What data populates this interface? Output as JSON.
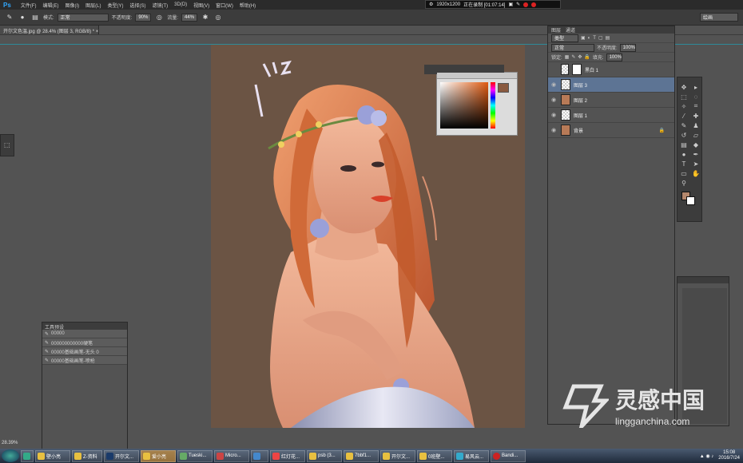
{
  "menubar": {
    "app_logo": "Ps",
    "items": [
      "文件(F)",
      "编辑(E)",
      "图像(I)",
      "图层(L)",
      "类型(Y)",
      "选择(S)",
      "滤镜(T)",
      "3D(D)",
      "视图(V)",
      "窗口(W)",
      "帮助(H)"
    ]
  },
  "recorder": {
    "resolution": "1920x1200",
    "status": "正在录制 [01:07:14]"
  },
  "options_bar": {
    "mode_label": "模式:",
    "mode_value": "正常",
    "opacity_label": "不透明度:",
    "opacity_value": "90%",
    "flow_label": "流量:",
    "flow_value": "44%",
    "workspace": "绘画"
  },
  "document_tab": {
    "title": "开尔文色温.jpg @ 28.4% (图层 3, RGB/8) * ×"
  },
  "layers_panel": {
    "tabs": [
      "图层",
      "通道"
    ],
    "filter_kind": "类型",
    "blend_mode": "正常",
    "opacity_label": "不透明度:",
    "opacity_value": "100%",
    "lock_label": "锁定:",
    "fill_label": "填充:",
    "fill_value": "100%",
    "layers": [
      {
        "name": "黑白 1",
        "thumb": "white",
        "selected": false,
        "visible": false
      },
      {
        "name": "图层 3",
        "thumb": "transparent",
        "selected": true,
        "visible": true
      },
      {
        "name": "图层 2",
        "thumb": "photo",
        "selected": false,
        "visible": true
      },
      {
        "name": "图层 1",
        "thumb": "transparent",
        "selected": false,
        "visible": true
      },
      {
        "name": "背景",
        "thumb": "photo",
        "selected": false,
        "visible": true,
        "locked": true
      }
    ]
  },
  "colors": {
    "foreground": "#b4876c",
    "background": "#ffffff",
    "canvas_bg": "#6b5444"
  },
  "tool_presets": {
    "title": "工具预设",
    "items": [
      "00000",
      "000000000000硬笔",
      "00000基础画笔-无头 0",
      "00000基础画笔-喷枪"
    ]
  },
  "status": {
    "zoom": "28.39%"
  },
  "taskbar": {
    "items": [
      "壁小亮",
      "Z-资料",
      "开尔文...",
      "爱小亮",
      "Tueski...",
      "Micro...",
      "",
      "红灯花...",
      "psb (3...",
      "7bbf1...",
      "开尔文...",
      "0班壁...",
      "易风云...",
      "Bandi..."
    ],
    "time": "15:08",
    "date": "2016/7/24"
  },
  "watermark": {
    "text": "灵感中国",
    "url": "lingganchina.com"
  }
}
